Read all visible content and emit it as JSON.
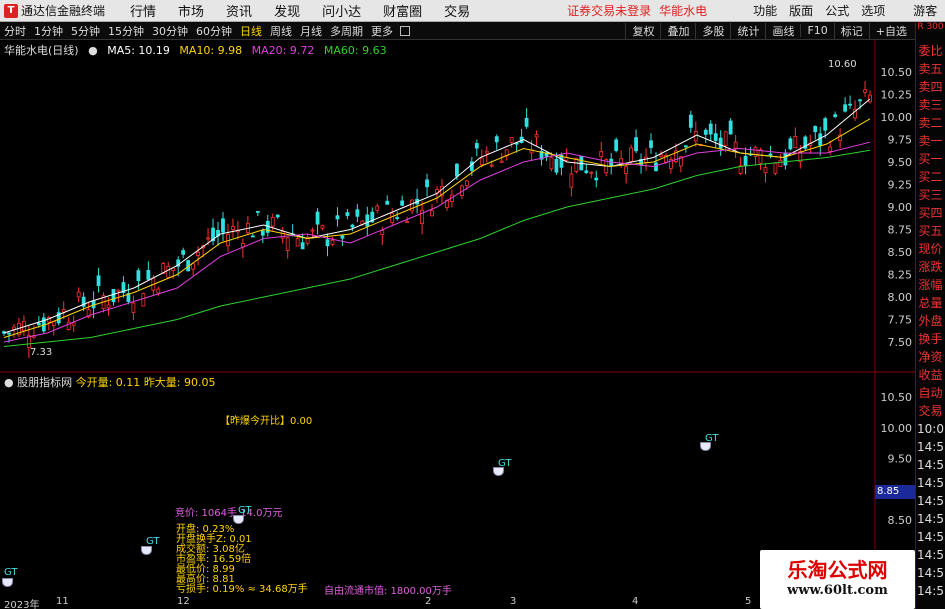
{
  "menubar": {
    "app_title": "通达信金融终端",
    "items": [
      "行情",
      "市场",
      "资讯",
      "发现",
      "问小达",
      "财富圈",
      "交易"
    ],
    "warning": "证券交易未登录",
    "stock_name": "华能水电",
    "right_items": [
      "功能",
      "版面",
      "公式",
      "选项"
    ],
    "guest": "游客"
  },
  "toolbar": {
    "periods": [
      "分时",
      "1分钟",
      "5分钟",
      "15分钟",
      "30分钟",
      "60分钟",
      "日线",
      "周线",
      "月线",
      "多周期",
      "更多"
    ],
    "active": "日线",
    "right_buttons": [
      "复权",
      "叠加",
      "多股",
      "统计",
      "画线",
      "F10",
      "标记",
      "+自选"
    ]
  },
  "main_chart": {
    "stock_label": "华能水电(日线)",
    "ma5_label": "MA5: 10.19",
    "ma10_label": "MA10: 9.98",
    "ma20_label": "MA20: 9.72",
    "ma60_label": "MA60: 9.63",
    "colors": {
      "ma5": "#ffffff",
      "ma10": "#ffd400",
      "ma20": "#e040e0",
      "ma60": "#30d030",
      "up": "#ff3030",
      "down": "#30e0e0"
    },
    "y_ticks": [
      "10.50",
      "10.25",
      "10.00",
      "9.75",
      "9.50",
      "9.25",
      "9.00",
      "8.75",
      "8.50",
      "8.25",
      "8.00",
      "7.75",
      "7.50"
    ],
    "high_marker": "10.60",
    "low_marker": "7.33"
  },
  "sub_chart": {
    "indicator_label": "股朋指标网",
    "today_open_label": "今开量: 0.11",
    "yesterday_vol_label": "昨大量: 90.05",
    "open_ratio": "【昨爆今开比】0.00",
    "y_ticks": [
      "10.50",
      "10.00",
      "9.50",
      "9.00",
      "8.50"
    ],
    "current_price": "8.85",
    "price_line": "竞价: 1064手 14.0万元",
    "info": [
      "开盘: 0.23%",
      "开盘换手Z: 0.01",
      "成交额: 3.08亿",
      "市盈率: 16.59倍",
      "最低价: 8.99",
      "最高价: 8.81",
      "亏损手: 0.19% ≈ 34.68万手"
    ],
    "self_text": "自由流通市值: 1800.00万手",
    "tags": [
      "GT",
      "GT",
      "GT",
      "GT",
      "GT"
    ]
  },
  "right_panel": {
    "top": "R 300",
    "items": [
      "委比",
      "卖五",
      "卖四",
      "卖三",
      "卖二",
      "卖一",
      "买一",
      "买二",
      "买三",
      "买四",
      "买五",
      "现价",
      "涨跌",
      "涨幅",
      "总量",
      "外盘",
      "换手",
      "净资",
      "收益",
      "自动",
      "交易",
      "10:0",
      "14:5",
      "14:5",
      "14:5",
      "14:5",
      "14:5",
      "14:5",
      "14:5",
      "14:5",
      "14:5"
    ]
  },
  "x_axis": [
    "2023年",
    "11",
    "12",
    "2",
    "3",
    "4",
    "5"
  ],
  "watermark": {
    "name": "乐淘公式网",
    "url": "www.60lt.com"
  },
  "chart_data": {
    "type": "line",
    "title": "",
    "series": [
      {
        "name": "MA5",
        "values": [
          7.6,
          7.75,
          7.95,
          8.1,
          8.35,
          8.7,
          8.8,
          8.65,
          8.75,
          8.95,
          9.15,
          9.55,
          9.75,
          9.5,
          9.45,
          9.55,
          9.8,
          9.6,
          9.55,
          9.8,
          10.2
        ]
      },
      {
        "name": "MA10",
        "values": [
          7.55,
          7.7,
          7.9,
          8.05,
          8.25,
          8.6,
          8.75,
          8.65,
          8.7,
          8.9,
          9.1,
          9.45,
          9.65,
          9.55,
          9.45,
          9.5,
          9.7,
          9.6,
          9.55,
          9.7,
          9.98
        ]
      },
      {
        "name": "MA20",
        "values": [
          7.5,
          7.6,
          7.8,
          7.95,
          8.1,
          8.45,
          8.65,
          8.7,
          8.6,
          8.8,
          9.0,
          9.3,
          9.5,
          9.6,
          9.5,
          9.45,
          9.6,
          9.65,
          9.6,
          9.6,
          9.72
        ]
      },
      {
        "name": "MA60",
        "values": [
          7.45,
          7.5,
          7.55,
          7.65,
          7.75,
          7.9,
          8.0,
          8.1,
          8.2,
          8.35,
          8.5,
          8.65,
          8.85,
          9.0,
          9.1,
          9.2,
          9.35,
          9.45,
          9.5,
          9.55,
          9.63
        ]
      }
    ],
    "ylim": [
      7.3,
      10.7
    ]
  }
}
